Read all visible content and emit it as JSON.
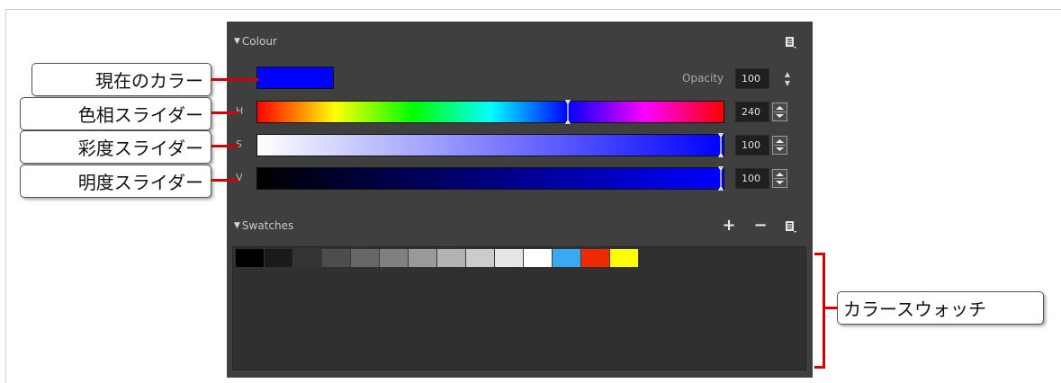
{
  "colour_panel": {
    "title": "Colour",
    "current_color": "#0000ff",
    "opacity_label": "Opacity",
    "opacity_value": "100",
    "sliders": [
      {
        "letter": "H",
        "value": "240",
        "position": 0.667
      },
      {
        "letter": "S",
        "value": "100",
        "position": 1.0
      },
      {
        "letter": "V",
        "value": "100",
        "position": 1.0
      }
    ]
  },
  "swatches_panel": {
    "title": "Swatches",
    "add_label": "+",
    "remove_label": "−",
    "swatches": [
      "#000000",
      "#1a1a1a",
      "#333333",
      "#4d4d4d",
      "#666666",
      "#808080",
      "#999999",
      "#b3b3b3",
      "#cccccc",
      "#e6e6e6",
      "#ffffff",
      "#3aa9f0",
      "#f02a00",
      "#ffff00"
    ]
  },
  "callouts": {
    "current_color": "現在のカラー",
    "hue_slider": "色相スライダー",
    "saturation_slider": "彩度スライダー",
    "value_slider": "明度スライダー",
    "colour_swatch": "カラースウォッチ"
  },
  "colors": {
    "panel_bg": "#3f3f3f",
    "callout_line": "#d40000"
  }
}
